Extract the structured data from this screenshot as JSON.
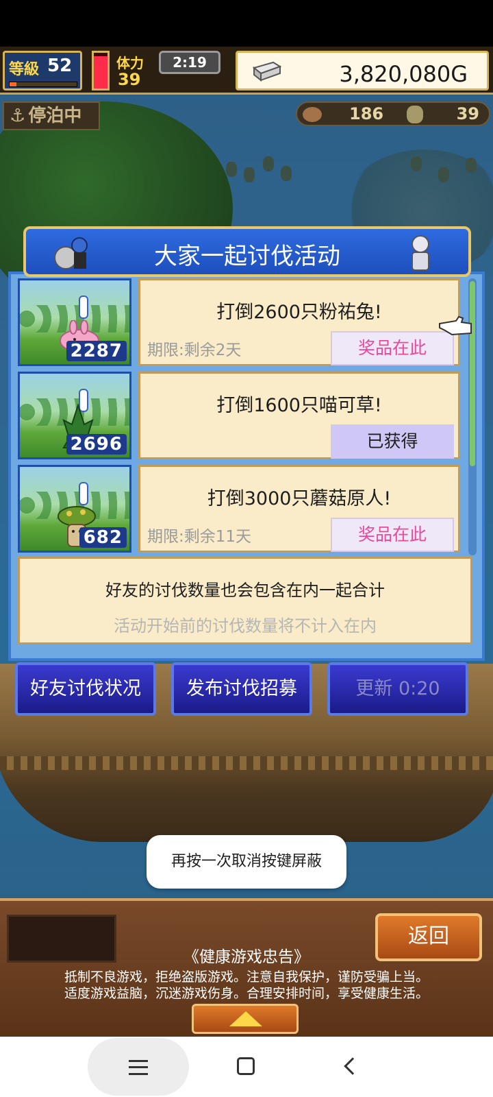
{
  "hud": {
    "level_label": "等級",
    "level_value": "52",
    "exp_fraction": 0.1,
    "stamina_fraction": 0.9,
    "stamina_label": "体力",
    "stamina_value": "39",
    "clock": "2:19",
    "gold": "3,820,080G",
    "docked_label": "停泊中",
    "resource1": "186",
    "resource2": "39"
  },
  "dialog": {
    "title": "大家一起讨伐活动",
    "quests": [
      {
        "count": "2287",
        "title": "打倒2600只粉祐兔!",
        "deadline": "期限:剩余2天",
        "button": "奖品在此",
        "claimed": false,
        "monster": "pink-rabbit"
      },
      {
        "count": "2696",
        "title": "打倒1600只喵可草!",
        "deadline": "",
        "button": "已获得",
        "claimed": true,
        "monster": "grass-monster"
      },
      {
        "count": "682",
        "title": "打倒3000只蘑菇原人!",
        "deadline": "期限:剩余11天",
        "button": "奖品在此",
        "claimed": false,
        "monster": "mushroom-man"
      }
    ],
    "note_line1": "好友的讨伐数量也会包含在内一起合计",
    "note_line2": "活动开始前的讨伐数量将不计入在内"
  },
  "actions": {
    "friends_status": "好友讨伐状况",
    "publish_recruit": "发布讨伐招募",
    "refresh": "更新 0:20"
  },
  "toast": "再按一次取消按键屏蔽",
  "bottom": {
    "back": "返回",
    "health_title": "《健康游戏忠告》",
    "health_line1": "抵制不良游戏，拒绝盗版游戏。注意自我保护，谨防受骗上当。",
    "health_line2": "适度游戏益脑，沉迷游戏伤身。合理安排时间，享受健康生活。"
  },
  "colors": {
    "dialog_header": "#2e6be0",
    "card_bg": "#fbecc9",
    "prize_text": "#e84a9a",
    "claimed_bg": "#cfc8f6"
  }
}
